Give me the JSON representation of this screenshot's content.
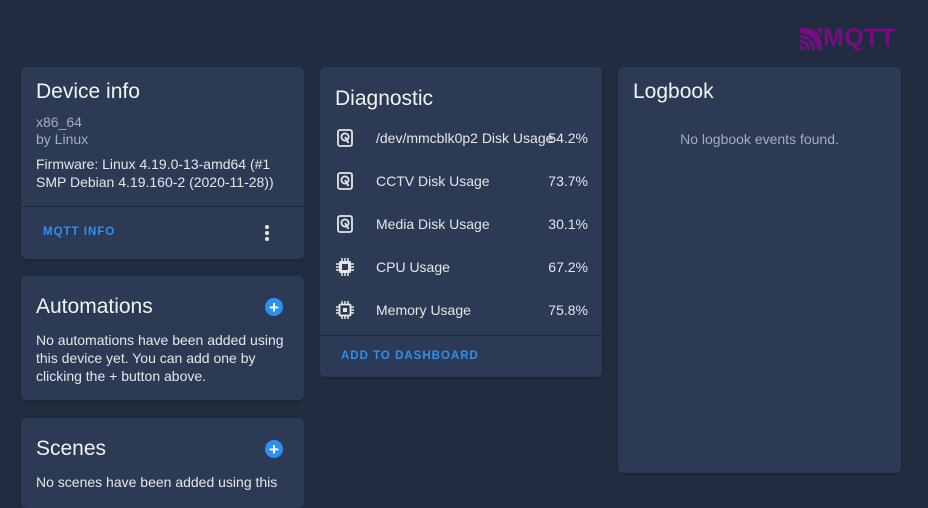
{
  "brand": {
    "logo_text": "MQTT",
    "color": "#7a0a86"
  },
  "accent_color": "#2f8ff0",
  "device_info": {
    "title": "Device info",
    "model": "x86_64",
    "manufacturer": "by Linux",
    "firmware": "Firmware: Linux 4.19.0-13-amd64 (#1 SMP Debian 4.19.160-2 (2020-11-28))",
    "action_label": "MQTT INFO",
    "menu_icon": "dots-vertical-icon"
  },
  "automations": {
    "title": "Automations",
    "text": "No automations have been added using this device yet. You can add one by clicking the + button above.",
    "add_icon": "plus-circle-icon"
  },
  "scenes": {
    "title": "Scenes",
    "text": "No scenes have been added using this",
    "add_icon": "plus-circle-icon"
  },
  "diagnostic": {
    "title": "Diagnostic",
    "rows": [
      {
        "icon": "harddisk-icon",
        "name": "/dev/mmcblk0p2 Disk Usage",
        "value": "54.2%"
      },
      {
        "icon": "harddisk-icon",
        "name": "CCTV Disk Usage",
        "value": "73.7%"
      },
      {
        "icon": "harddisk-icon",
        "name": "Media Disk Usage",
        "value": "30.1%"
      },
      {
        "icon": "cpu-icon",
        "name": "CPU Usage",
        "value": "67.2%"
      },
      {
        "icon": "memory-icon",
        "name": "Memory Usage",
        "value": "75.8%"
      }
    ],
    "action_label": "ADD TO DASHBOARD"
  },
  "logbook": {
    "title": "Logbook",
    "empty_text": "No logbook events found."
  }
}
